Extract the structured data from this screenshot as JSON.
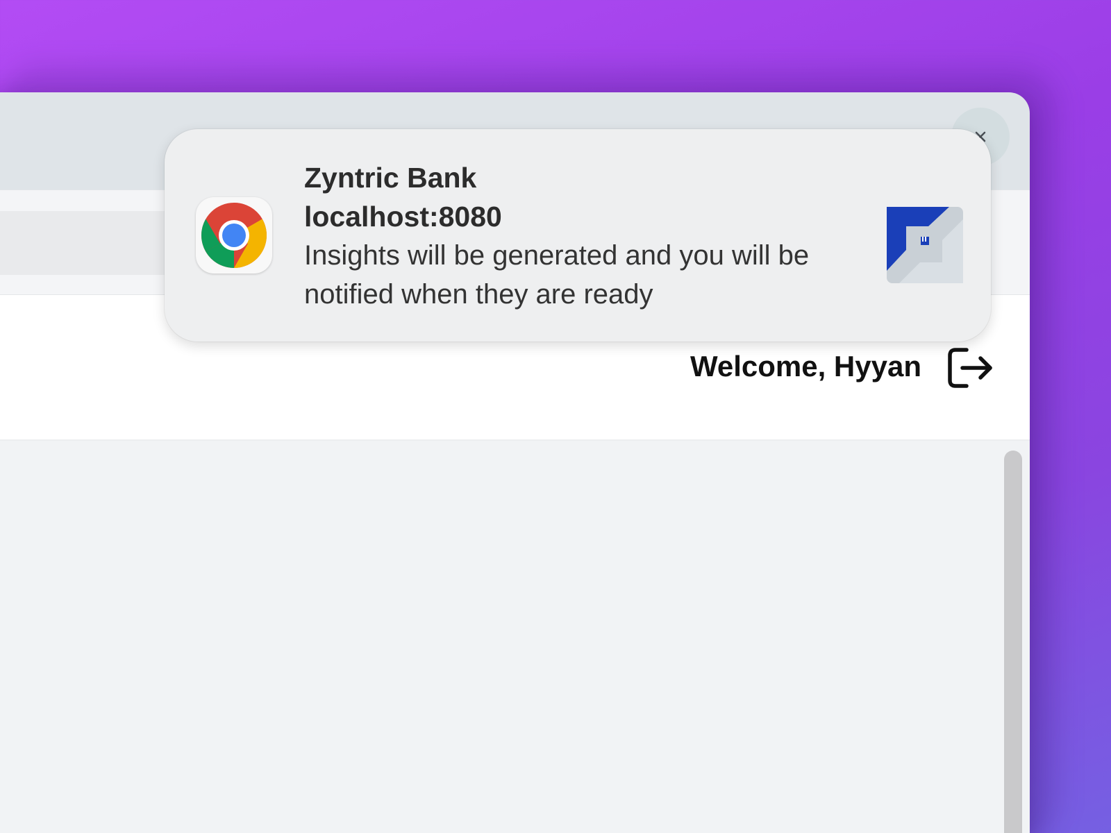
{
  "notification": {
    "title": "Zyntric Bank",
    "subtitle": "localhost:8080",
    "body": "Insights will be generated and you will be notified when they are ready",
    "app_icon": "chrome-icon",
    "image_icon": "zyntric-bank-logo"
  },
  "header": {
    "welcome_text": "Welcome, Hyyan",
    "logout_icon": "logout-icon"
  },
  "colors": {
    "desktop_gradient_start": "#b34cf4",
    "desktop_gradient_end": "#7560e2",
    "bank_logo_blue": "#1a3fb8",
    "bank_logo_gray": "#c9d0d6"
  }
}
